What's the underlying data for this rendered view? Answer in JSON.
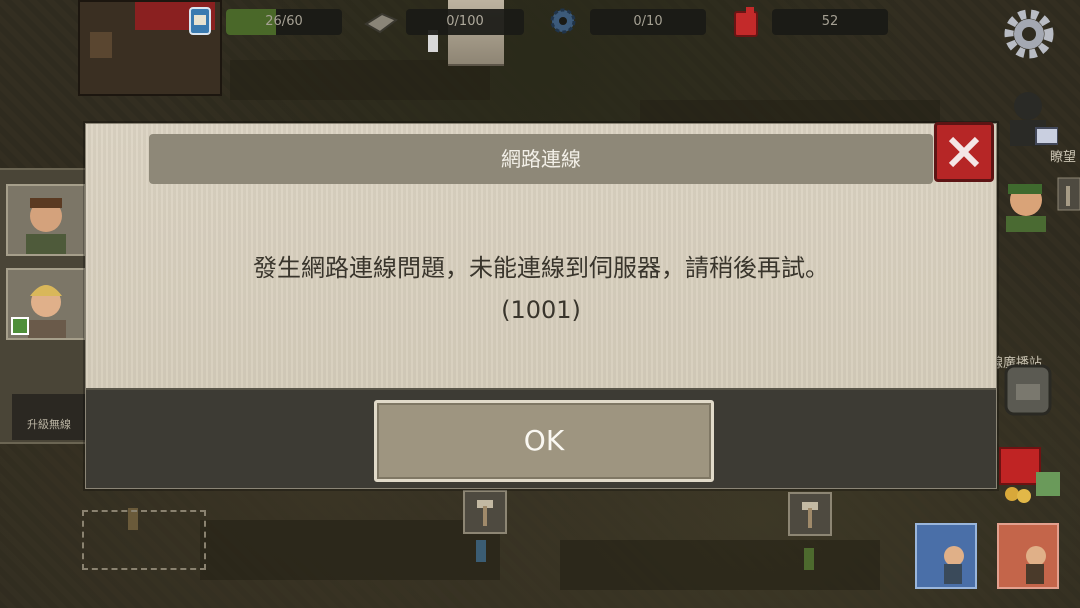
{
  "resources": {
    "food": "26/60",
    "food_fraction": 0.43,
    "materials": "0/100",
    "parts": "0/10",
    "fuel": "52"
  },
  "dialog": {
    "title": "網路連線",
    "message": "發生網路連線問題，未能連線到伺服器，請稍後再試。",
    "code": "(1001)",
    "ok_label": "OK"
  },
  "left_panel": {
    "upgrade_label": "升級無線"
  },
  "right_panel": {
    "label_top": "瞭望",
    "label_mid": "線廣播站"
  },
  "colors": {
    "close_red": "#b62626",
    "food_green": "#4d6e2a"
  }
}
